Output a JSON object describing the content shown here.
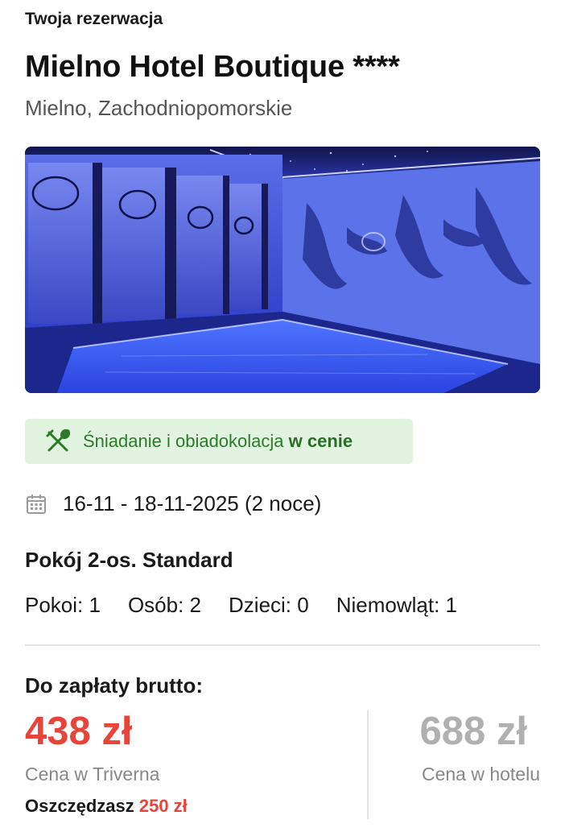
{
  "header": {
    "eyebrow": "Twoja rezerwacja",
    "hotel_name": "Mielno Hotel Boutique ****",
    "location": "Mielno, Zachodniopomorskie"
  },
  "photo": {
    "description_icon": "hotel-pool-photo"
  },
  "meal": {
    "icon": "cutlery-icon",
    "text": "Śniadanie i obiadokolacja ",
    "included": "w cenie",
    "bg_color": "#e1f4df",
    "text_color": "#2e7a2a"
  },
  "stay": {
    "icon": "calendar-icon",
    "dates": "16-11 - 18-11-2025 (2 noce)"
  },
  "room": {
    "name": "Pokój 2-os. Standard"
  },
  "occupancy": {
    "rooms": "Pokoi: 1",
    "persons": "Osób: 2",
    "children": "Dzieci: 0",
    "infants": "Niemowląt: 1"
  },
  "pricing": {
    "to_pay_label": "Do zapłaty brutto:",
    "triverna_price": "438 zł",
    "triverna_label": "Cena w Triverna",
    "savings_label": "Oszczędzasz ",
    "savings_amount": "250 zł",
    "hotel_price": "688 zł",
    "hotel_label": "Cena w hotelu",
    "accent_color": "#e8443a",
    "muted_color": "#b0b0b0"
  }
}
